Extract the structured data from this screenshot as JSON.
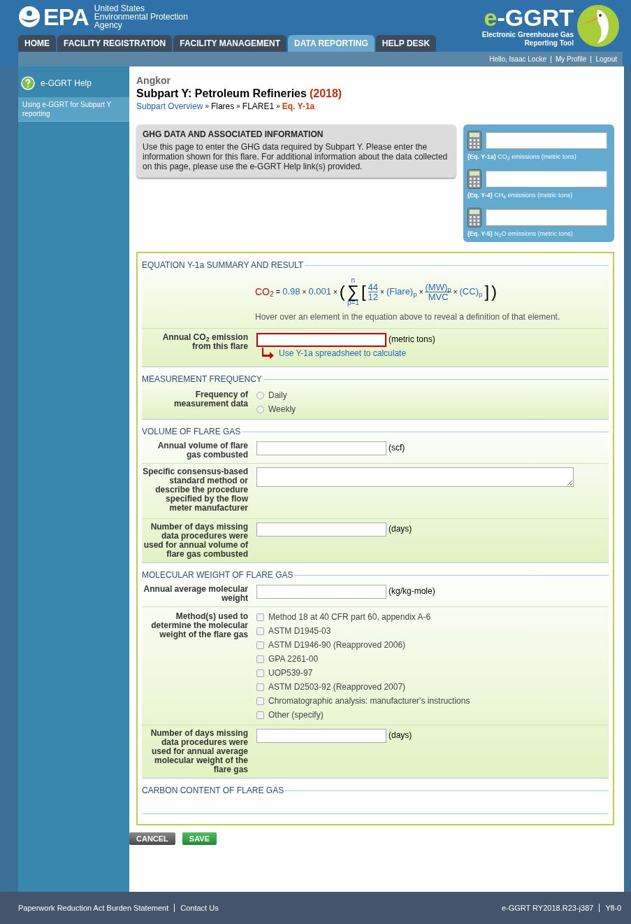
{
  "header": {
    "agency": [
      "United States",
      "Environmental Protection",
      "Agency"
    ],
    "agency_logo": "EPA",
    "tool_logo": "e-GGRT",
    "tool_name": [
      "Electronic Greenhouse Gas",
      "Reporting Tool"
    ]
  },
  "nav_tabs": [
    {
      "label": "HOME",
      "selected": false
    },
    {
      "label": "FACILITY REGISTRATION",
      "selected": false
    },
    {
      "label": "FACILITY MANAGEMENT",
      "selected": false
    },
    {
      "label": "DATA REPORTING",
      "selected": true
    },
    {
      "label": "HELP DESK",
      "selected": false
    }
  ],
  "user_links": [
    "Hello, Isaac Locke",
    "My Profile",
    "Logout"
  ],
  "sidebar": {
    "title": "e-GGRT Help",
    "items": [
      "Using e-GGRT for Subpart Y reporting"
    ]
  },
  "facility": "Angkor",
  "page_title": "Subpart Y: Petroleum Refineries",
  "year": "(2018)",
  "breadcrumb_separator": "»",
  "breadcrumb": [
    {
      "label": "Subpart Overview",
      "kind": "link"
    },
    {
      "label": "Flares",
      "kind": "text"
    },
    {
      "label": "FLARE1",
      "kind": "text"
    },
    {
      "label": "Eq. Y-1a",
      "kind": "current"
    }
  ],
  "info_box": {
    "title": "GHG DATA AND ASSOCIATED INFORMATION",
    "text": "Use this page to enter the GHG data required by Subpart Y. Please enter the information shown for this flare. For additional information about the data collected on this page, please use the e-GGRT Help link(s) provided."
  },
  "calculators": [
    {
      "eq": "(Eq. Y-1a)",
      "label": "CO$_{2}$ emissions (metric tons)"
    },
    {
      "eq": "(Eq. Y-4)",
      "label": "CH$_{4}$ emissions (metric tons)"
    },
    {
      "eq": "(Eq. Y-5)",
      "label": "N$_{2}$O emissions (metric tons)"
    }
  ],
  "equation_section": {
    "title": "EQUATION Y-1a SUMMARY AND RESULT",
    "equation": {
      "lhs": "CO$_{2}$",
      "eq": "=",
      "c1": "0.98",
      "x1": "×",
      "c2": "0.001",
      "x2": "×",
      "lp": "(",
      "upper": "n",
      "sigma": "∑",
      "lower": "p=1",
      "lb": "[",
      "num": "44",
      "den": "12",
      "x3": "×",
      "flare": "(Flare)$_{p}$",
      "x4": "×",
      "mw": "(MW)$_{p}$",
      "mvc": "MVC",
      "x5": "×",
      "cc": "(CC)$_{p}$",
      "rb": "]",
      "rp": ")"
    },
    "hint": "Hover over an element in the equation above to reveal a definition of that element.",
    "field": {
      "label": "Annual CO$_{2}$ emission from this flare",
      "unit": "(metric tons)",
      "error": true
    },
    "link": "Use Y-1a spreadsheet to calculate"
  },
  "sections": [
    {
      "title": "MEASUREMENT FREQUENCY",
      "rows": [
        {
          "kind": "radio",
          "label": "Frequency of measurement data",
          "options": [
            {
              "label": "Daily",
              "selected": false
            },
            {
              "label": "Weekly",
              "selected": false
            }
          ]
        }
      ]
    },
    {
      "title": "VOLUME OF FLARE GAS",
      "rows": [
        {
          "kind": "input",
          "label": "Annual volume of flare gas combusted",
          "unit": "(scf)"
        },
        {
          "kind": "textarea",
          "label": "Specific consensus-based standard method or describe the procedure specified by the flow meter manufacturer"
        },
        {
          "kind": "input",
          "label": "Number of days missing data procedures were used for annual volume of flare gas combusted",
          "unit": "(days)"
        }
      ]
    },
    {
      "title": "MOLECULAR WEIGHT OF FLARE GAS",
      "rows": [
        {
          "kind": "input",
          "label": "Annual average molecular weight",
          "unit": "(kg/kg-mole)"
        },
        {
          "kind": "checkbox",
          "label": "Method(s) used to determine the molecular weight of the flare gas",
          "options": [
            {
              "label": "Method 18 at 40 CFR part 60, appendix A-6",
              "checked": false
            },
            {
              "label": "ASTM D1945-03",
              "checked": false
            },
            {
              "label": "ASTM D1946-90 (Reapproved 2006)",
              "checked": false
            },
            {
              "label": "GPA 2261-00",
              "checked": false
            },
            {
              "label": "UOP539-97",
              "checked": false
            },
            {
              "label": "ASTM D2503-92 (Reapproved 2007)",
              "checked": false
            },
            {
              "label": "Chromatographic analysis: manufacturer's instructions",
              "checked": false
            },
            {
              "label": "Other (specify)",
              "checked": false
            }
          ]
        },
        {
          "kind": "input",
          "label": "Number of days missing data procedures were used for annual average molecular weight of the flare gas",
          "unit": "(days)"
        }
      ]
    },
    {
      "title": "CARBON CONTENT OF FLARE GAS"
    }
  ],
  "buttons": [
    {
      "label": "CANCEL",
      "kind": "cancel"
    },
    {
      "label": "SAVE",
      "kind": "save"
    }
  ],
  "footer": {
    "left": [
      "Paperwork Reduction Act Burden Statement",
      "Contact Us"
    ],
    "right": [
      "e-GGRT RY2018.R23-j387",
      "Yfl-0"
    ]
  }
}
